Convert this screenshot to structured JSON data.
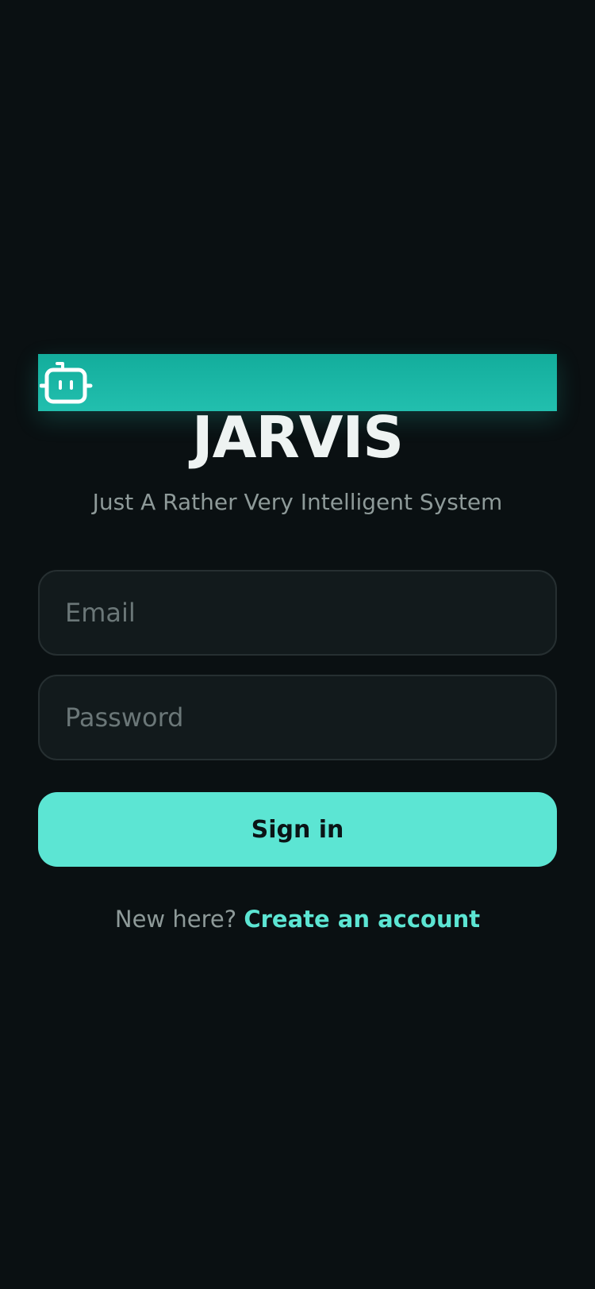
{
  "app": {
    "title": "JARVIS",
    "subtitle": "Just A Rather Very Intelligent System",
    "logo_icon": "robot-icon"
  },
  "form": {
    "email_placeholder": "Email",
    "email_value": "",
    "password_placeholder": "Password",
    "password_value": "",
    "signin_label": "Sign in"
  },
  "footer": {
    "prompt": "New here?",
    "link_label": "Create an account"
  },
  "colors": {
    "background": "#0a1012",
    "banner": "#19b6a4",
    "accent": "#5ce5d3",
    "field_bg": "#121a1c",
    "field_border": "#262f31",
    "muted_text": "#8e9a99"
  }
}
